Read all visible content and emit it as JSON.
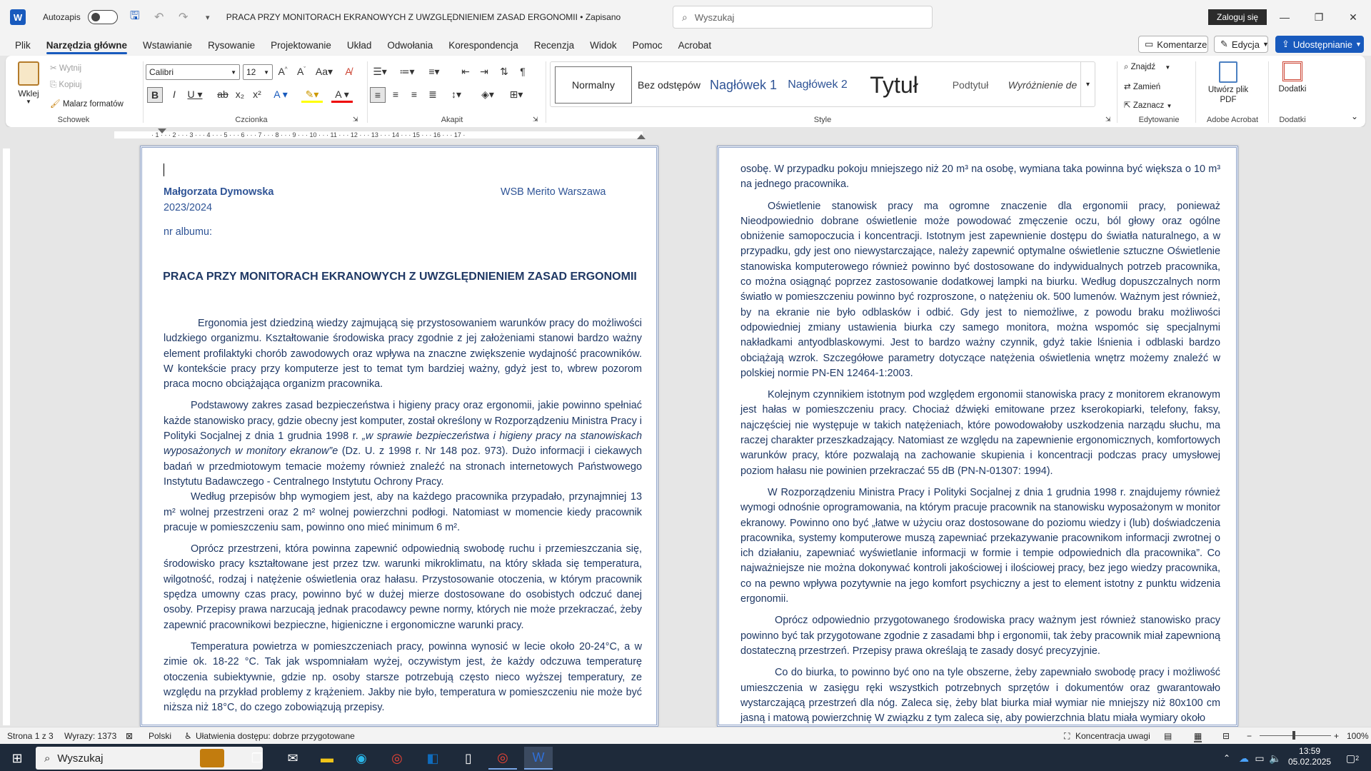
{
  "titlebar": {
    "autosave": "Autozapis",
    "doc_title": "PRACA PRZY MONITORACH EKRANOWYCH Z UWZGLĘDNIENIEM ZASAD ERGONOMII  •  Zapisano",
    "search_placeholder": "Wyszukaj",
    "login": "Zaloguj się"
  },
  "menu": {
    "items": [
      "Plik",
      "Narzędzia główne",
      "Wstawianie",
      "Rysowanie",
      "Projektowanie",
      "Układ",
      "Odwołania",
      "Korespondencja",
      "Recenzja",
      "Widok",
      "Pomoc",
      "Acrobat"
    ],
    "active": "Narzędzia główne",
    "comments": "Komentarze",
    "edit": "Edycja",
    "share": "Udostępnianie"
  },
  "ribbon": {
    "clipboard": {
      "paste": "Wklej",
      "cut": "Wytnij",
      "copy": "Kopiuj",
      "painter": "Malarz formatów",
      "label": "Schowek"
    },
    "font": {
      "name": "Calibri",
      "size": "12",
      "label": "Czcionka"
    },
    "paragraph": {
      "label": "Akapit"
    },
    "styles": {
      "items": [
        "Normalny",
        "Bez odstępów",
        "Nagłówek 1",
        "Nagłówek 2",
        "Tytuł",
        "Podtytuł",
        "Wyróżnienie de"
      ],
      "label": "Style"
    },
    "editing": {
      "find": "Znajdź",
      "replace": "Zamień",
      "select": "Zaznacz",
      "label": "Edytowanie"
    },
    "acrobat": {
      "create_pdf": "Utwórz plik PDF",
      "label": "Adobe Acrobat"
    },
    "addins": {
      "btn": "Dodatki",
      "label": "Dodatki"
    }
  },
  "ruler": {
    "ticks": "· 1 · · · 2 · · · 3 · · · 4 · · · 5 · · · 6 · · · 7 · · · 8 · · · 9 · · · 10 · · · 11 · · · 12 · · · 13 · · · 14 · · · 15 · · · 16 · · · 17 ·"
  },
  "page1": {
    "author": "Małgorzata Dymowska",
    "year": "2023/2024",
    "school": "WSB Merito Warszawa",
    "album": "nr albumu:",
    "title": "PRACA PRZY MONITORACH EKRANOWYCH Z UWZGLĘDNIENIEM ZASAD ERGONOMII",
    "p1": "Ergonomia jest dziedziną wiedzy zajmującą się przystosowaniem warunków pracy do możliwości ludzkiego organizmu. Kształtowanie środowiska pracy zgodnie z jej założeniami stanowi bardzo ważny element profilaktyki chorób zawodowych oraz wpływa na znaczne  zwiększenie wydajność pracowników. W kontekście pracy przy komputerze jest to temat tym bardziej ważny, gdyż jest to, wbrew pozorom praca mocno obciążająca organizm pracownika.",
    "p2a": "Podstawowy zakres zasad bezpieczeństwa i higieny pracy oraz ergonomii, jakie powinno spełniać każde stanowisko pracy, gdzie obecny jest komputer, został określony  w Rozporządzeniu Ministra Pracy i Polityki Socjalnej z dnia 1 grudnia 1998 r. ",
    "p2b": "„w sprawie bezpieczeństwa i higieny pracy na stanowiskach wyposażonych w monitory ekranow”e",
    "p2c": " (Dz. U. z 1998 r. Nr 148 poz. 973). Dużo informacji i ciekawych badań w przedmiotowym temacie możemy również znaleźć na stronach internetowych Państwowego Instytutu Badawczego - Centralnego Instytutu Ochrony Pracy.",
    "p3": "Według przepisów bhp wymogiem jest, aby na każdego pracownika przypadało, przynajmniej 13 m² wolnej  przestrzeni oraz 2 m² wolnej powierzchni podłogi. Natomiast w momencie kiedy pracownik pracuje w pomieszczeniu sam, powinno ono  mieć minimum 6 m².",
    "p4": "Oprócz przestrzeni, która powinna zapewnić odpowiednią swobodę ruchu i przemieszczania się, środowisko pracy kształtowane jest przez tzw. warunki mikroklimatu, na który składa się temperatura, wilgotność, rodzaj i natężenie oświetlenia oraz hałasu. Przystosowanie otoczenia, w którym pracownik spędza umowny czas pracy, powinno być w dużej mierze dostosowane do osobistych odczuć danej osoby. Przepisy prawa narzucają jednak pracodawcy pewne normy, których nie może przekraczać, żeby zapewnić pracownikowi bezpieczne, higieniczne i ergonomiczne warunki pracy.",
    "p5": "Temperatura powietrza w pomieszczeniach pracy, powinna wynosić w lecie około 20-24°C, a w zimie ok. 18-22 °C. Tak jak wspomniałam wyżej, oczywistym jest, że każdy odczuwa temperaturę otoczenia subiektywnie, gdzie np. osoby starsze potrzebują często nieco wyższej temperatury, ze względu na przykład problemy z krążeniem. Jakby nie było, temperatura w pomieszczeniu nie może być niższa niż 18°C, do czego zobowiązują przepisy."
  },
  "page2": {
    "p0": "osobę. W przypadku pokoju mniejszego niż 20 m³ na osobę, wymiana taka powinna być większa o 10 m³ na jednego pracownika.",
    "p1": "Oświetlenie stanowisk pracy ma ogromne znaczenie dla ergonomii pracy, ponieważ Nieodpowiednio dobrane oświetlenie może powodować zmęczenie oczu, ból głowy oraz ogólne obniżenie samopoczucia i koncentracji. Istotnym jest zapewnienie dostępu do światła naturalnego, a w przypadku, gdy jest ono niewystarczające, należy zapewnić optymalne oświetlenie sztuczne Oświetlenie stanowiska komputerowego również powinno być dostosowane do indywidualnych potrzeb pracownika, co można osiągnąć poprzez zastosowanie dodatkowej lampki na biurku. Według dopuszczalnych norm światło w pomieszczeniu powinno być rozproszone, o natężeniu ok. 500 lumenów. Ważnym jest również, by na ekranie nie było odblasków i odbić. Gdy jest to niemożliwe, z powodu braku możliwości odpowiedniej zmiany ustawienia biurka czy samego monitora, można wspomóc się specjalnymi nakładkami antyodblaskowymi. Jest to bardzo ważny czynnik, gdyż takie lśnienia i odblaski bardzo obciążają wzrok. Szczegółowe parametry dotyczące natężenia oświetlenia wnętrz możemy znaleźć w polskiej normie  PN-EN 12464-1:2003.",
    "p2": "Kolejnym czynnikiem istotnym pod względem ergonomii stanowiska pracy z monitorem ekranowym jest hałas w pomieszczeniu pracy. Chociaż dźwięki emitowane przez kserokopiarki, telefony, faksy, najczęściej nie występuje w takich natężeniach, które powodowałoby uszkodzenia narządu słuchu, ma raczej charakter przeszkadzający. Natomiast ze względu na zapewnienie ergonomicznych, komfortowych warunków pracy, które pozwalają na zachowanie skupienia i koncentracji podczas pracy umysłowej poziom hałasu nie powinien przekraczać 55 dB (PN-N-01307: 1994).",
    "p3": "W Rozporządzeniu Ministra Pracy i Polityki Socjalnej z dnia 1 grudnia 1998 r. znajdujemy również wymogi odnośnie oprogramowania, na którym pracuje pracownik na stanowisku wyposażonym w monitor ekranowy. Powinno ono być „łatwe w użyciu oraz dostosowane do poziomu wiedzy i (lub) doświadczenia pracownika, systemy komputerowe muszą zapewniać przekazywanie pracownikom informacji zwrotnej o ich działaniu, zapewniać wyświetlanie informacji w formie i tempie odpowiednich dla pracownika”. Co najważniejsze nie można dokonywać kontroli jakościowej i ilościowej pracy, bez jego wiedzy pracownika, co na pewno wpływa pozytywnie na jego komfort psychiczny a jest to element istotny z punktu widzenia ergonomii.",
    "p4": "Oprócz odpowiednio przygotowanego środowiska pracy ważnym jest również stanowisko pracy powinno być tak przygotowane zgodnie z zasadami bhp i ergonomii, tak żeby pracownik miał zapewnioną dostateczną przestrzeń. Przepisy prawa określają te zasady dosyć precyzyjnie.",
    "p5": "Co do biurka, to powinno być ono na tyle obszerne, żeby zapewniało swobodę pracy i możliwość umieszczenia w zasięgu ręki wszystkich potrzebnych sprzętów i dokumentów oraz gwarantowało wystarczającą przestrzeń dla nóg. Zaleca się, żeby blat biurka miał wymiar nie mniejszy niż 80x100 cm jasną i matową powierzchnię W związku z tym zaleca się, aby powierzchnia blatu miała wymiary około"
  },
  "status": {
    "page": "Strona 1 z 3",
    "words": "Wyrazy: 1373",
    "lang": "Polski",
    "accessibility": "Ułatwienia dostępu: dobrze przygotowane",
    "focus": "Koncentracja uwagi",
    "zoom": "100%"
  },
  "taskbar": {
    "search": "Wyszukaj",
    "time": "13:59",
    "date": "05.02.2025",
    "notif": "2"
  }
}
